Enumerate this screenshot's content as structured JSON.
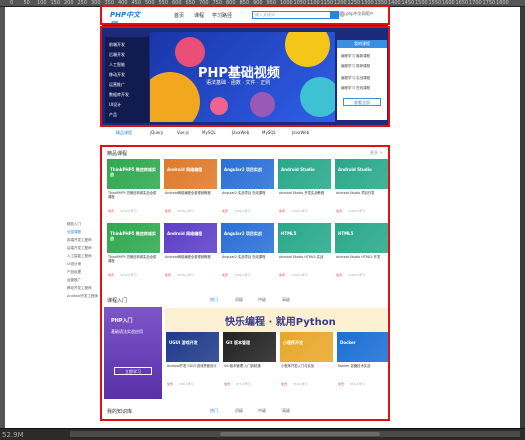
{
  "ruler": {
    "ticks": [
      "0",
      "50",
      "100",
      "150",
      "200",
      "250",
      "300",
      "350",
      "400",
      "450",
      "500",
      "550",
      "600",
      "650",
      "700",
      "750",
      "800",
      "850",
      "900",
      "950",
      "1000",
      "1050",
      "1100",
      "1150",
      "1200",
      "1250",
      "1300",
      "1350",
      "1400",
      "1450",
      "1500",
      "1550",
      "1600",
      "1650",
      "1700",
      "1750",
      "1800"
    ]
  },
  "status": {
    "zoom": "52.9M"
  },
  "header": {
    "logo": "PHP中文网",
    "nav": [
      "首页",
      "课程",
      "学习路径"
    ],
    "search_placeholder": "输入关键词",
    "user": "php中文网用户"
  },
  "sidemenu": [
    "前端开发",
    "后端开发",
    "人工智能",
    "移动开发",
    "运营推广",
    "数据库开发",
    "UI设计",
    "产品"
  ],
  "hero": {
    "title": "PHP基础视频",
    "subtitle": "语法基础 · 函数 · 文件 · 正则"
  },
  "login": {
    "title": "我的课程",
    "rows": [
      "编程学习 最新课程",
      "编程学习 推荐课程",
      "编程学习 实战课程",
      "编程学习 在线课程"
    ],
    "button": "查看全部"
  },
  "tags": [
    "精品课程",
    "jQuery",
    "Vue.js",
    "MySQL",
    "JavaWeb",
    "MySQL",
    "JavaWeb"
  ],
  "leftnav": [
    "精品入门",
    "全部课程",
    "前端开发工程师",
    "后端开发工程师",
    "人工智能工程师",
    "UI设计师",
    "产品经理",
    "运营推广",
    "移动开发工程师",
    "Android开发工程师"
  ],
  "sections": {
    "s1": {
      "title": "精品课程",
      "more": "更多 >"
    },
    "s2": {
      "title": "课程入门",
      "tabs": [
        "热门",
        "初级",
        "中级",
        "高级"
      ]
    },
    "s3": {
      "title": "我的知识库",
      "tabs": [
        "热门",
        "初级",
        "中级",
        "高级"
      ]
    }
  },
  "cards_row1": [
    {
      "cap": "ThinkPHP5 微信商城实战",
      "title": "ThinkPHP5 仿微信商城实战全套课程",
      "meta": "免费",
      "views": "2145人学习",
      "color": "#2fa84f"
    },
    {
      "cap": "Android 网络编程",
      "title": "Android网络编程全套视频教程",
      "meta": "免费",
      "views": "1876人学习",
      "color": "#e07a2a"
    },
    {
      "cap": "Angular2 项目实战",
      "title": "Angular2 实战项目 在线课程",
      "meta": "免费",
      "views": "1560人学习",
      "color": "#2a6fd6"
    },
    {
      "cap": "Android Studio",
      "title": "Android Studio 开发实战教程",
      "meta": "免费",
      "views": "1342人学习",
      "color": "#27a88a"
    },
    {
      "cap": "Android Studio",
      "title": "Android Studio 项目开发",
      "meta": "免费",
      "views": "1203人学习",
      "color": "#27a88a"
    }
  ],
  "cards_row2": [
    {
      "cap": "ThinkPHP5 微信商城实战",
      "title": "ThinkPHP5 仿微信商城实战全套课程",
      "meta": "免费",
      "views": "2145人学习",
      "color": "#2fa84f"
    },
    {
      "cap": "Android 网络编程",
      "title": "Android网络编程全套视频教程",
      "meta": "免费",
      "views": "1876人学习",
      "color": "#5b3fc7"
    },
    {
      "cap": "Angular2 项目实战",
      "title": "Angular2 实战项目 在线课程",
      "meta": "免费",
      "views": "1560人学习",
      "color": "#2a6fd6"
    },
    {
      "cap": "HTML5",
      "title": "Android Studio HTML5 实战",
      "meta": "免费",
      "views": "1342人学习",
      "color": "#27a88a"
    },
    {
      "cap": "HTML5",
      "title": "Android Studio HTML5 开发",
      "meta": "免费",
      "views": "1203人学习",
      "color": "#27a88a"
    }
  ],
  "python": {
    "text": "快乐编程 · 就用Python"
  },
  "php_card": {
    "title": "PHP入门",
    "sub": "基础语法实战应用",
    "button": "立即学习"
  },
  "cards_row3": [
    {
      "cap": "UGUI 游戏开发",
      "title": "Android开发 UGUI 游戏界面设计",
      "meta": "免费",
      "views": "980人学习",
      "color": "#1e3a8a"
    },
    {
      "cap": "Git 版本管理",
      "title": "Git 版本管理 入门到精通",
      "meta": "免费",
      "views": "870人学习",
      "color": "#222"
    },
    {
      "cap": "小程序开发",
      "title": "小程序开发入门与实战",
      "meta": "免费",
      "views": "760人学习",
      "color": "#e8a72a"
    },
    {
      "cap": "Docker",
      "title": "Docker 容器技术实战",
      "meta": "免费",
      "views": "650人学习",
      "color": "#1b6fd6"
    }
  ]
}
